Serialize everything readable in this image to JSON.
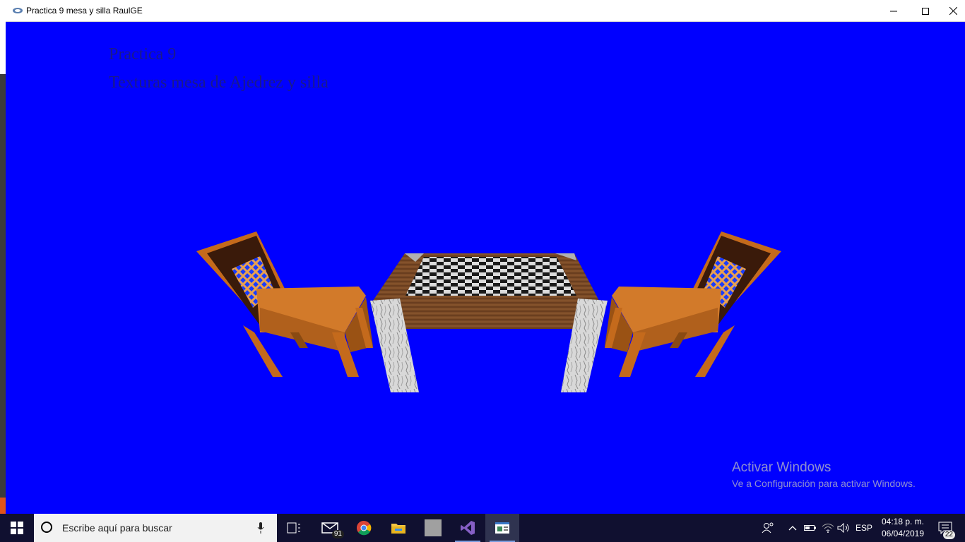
{
  "window": {
    "title": "Practica 9 mesa y silla RaulGE",
    "minimize_label": "—",
    "maximize_label": "☐",
    "close_label": "✕"
  },
  "scene": {
    "line1": "Practica 9",
    "line2": "Texturas mesa de Ajedrez y silla",
    "background_color": "#0000ff"
  },
  "watermark": {
    "title": "Activar Windows",
    "subtitle": "Ve a Configuración para activar Windows."
  },
  "taskbar": {
    "search_placeholder": "Escribe aquí para buscar",
    "mail_badge": "91",
    "language": "ESP",
    "time": "04:18 p. m.",
    "date": "06/04/2019",
    "notifications_badge": "22",
    "apps": [
      "task-view",
      "mail",
      "chrome",
      "file-explorer",
      "blank-app",
      "visual-studio",
      "opengl-window"
    ]
  }
}
